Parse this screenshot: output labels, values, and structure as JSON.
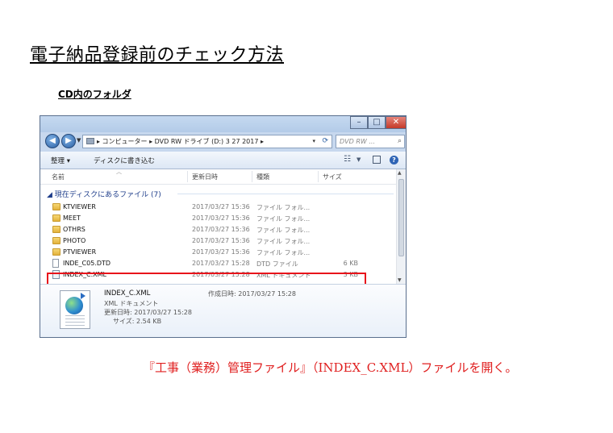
{
  "page_title": "電子納品登録前のチェック方法",
  "section_label": "CD内のフォルダ",
  "window": {
    "title_buttons": {
      "minimize": "–",
      "maximize": "□",
      "close": "✕"
    },
    "address_path": "▸ コンピューター ▸ DVD RW ドライブ (D:) 3 27 2017 ▸",
    "search_placeholder": "DVD RW ...",
    "toolbar": {
      "organize": "整理 ▾",
      "burn": "ディスクに書き込む"
    },
    "columns": {
      "name": "名前",
      "date": "更新日時",
      "type": "種類",
      "size": "サイズ"
    },
    "group_header": "現在ディスクにあるファイル (7)",
    "files": [
      {
        "name": "KTVIEWER",
        "date": "2017/03/27 15:36",
        "type": "ファイル フォル...",
        "size": "",
        "icon": "folder-icon"
      },
      {
        "name": "MEET",
        "date": "2017/03/27 15:36",
        "type": "ファイル フォル...",
        "size": "",
        "icon": "folder-icon"
      },
      {
        "name": "OTHRS",
        "date": "2017/03/27 15:36",
        "type": "ファイル フォル...",
        "size": "",
        "icon": "folder-icon"
      },
      {
        "name": "PHOTO",
        "date": "2017/03/27 15:36",
        "type": "ファイル フォル...",
        "size": "",
        "icon": "folder-icon"
      },
      {
        "name": "PTVIEWER",
        "date": "2017/03/27 15:36",
        "type": "ファイル フォル...",
        "size": "",
        "icon": "folder-icon"
      },
      {
        "name": "INDE_C05.DTD",
        "date": "2017/03/27 15:28",
        "type": "DTD ファイル",
        "size": "6 KB",
        "icon": "document-icon"
      },
      {
        "name": "INDEX_C.XML",
        "date": "2017/03/27 15:28",
        "type": "XML ドキュメント",
        "size": "3 KB",
        "icon": "xml-file-icon"
      }
    ],
    "highlight_color": "#e8141b",
    "details": {
      "name": "INDEX_C.XML",
      "type": "XML ドキュメント",
      "modified": "更新日時: 2017/03/27 15:28",
      "size": "サイズ: 2.54 KB",
      "created": "作成日時: 2017/03/27 15:28"
    }
  },
  "instruction": "『工事（業務）管理ファイル』（INDEX_C.XML）ファイルを開く。",
  "instruction_color": "#e02020"
}
